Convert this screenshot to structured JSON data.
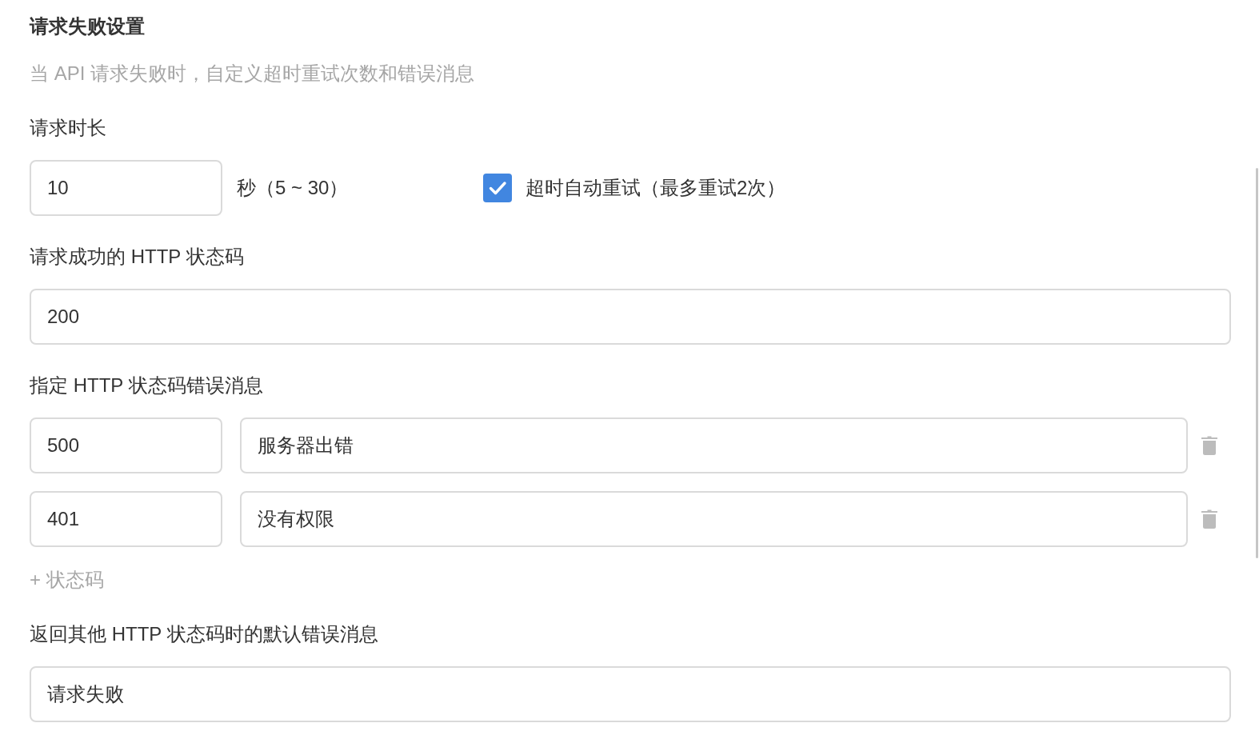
{
  "section": {
    "title": "请求失败设置",
    "description": "当 API 请求失败时，自定义超时重试次数和错误消息"
  },
  "timeout": {
    "label": "请求时长",
    "value": "10",
    "unit": "秒（5 ~ 30）",
    "auto_retry": {
      "label": "超时自动重试（最多重试2次）",
      "checked": true
    }
  },
  "success_code": {
    "label": "请求成功的 HTTP 状态码",
    "value": "200"
  },
  "error_messages": {
    "label": "指定 HTTP 状态码错误消息",
    "rows": [
      {
        "code": "500",
        "message": "服务器出错"
      },
      {
        "code": "401",
        "message": "没有权限"
      }
    ],
    "add_button": "+ 状态码"
  },
  "default_error": {
    "label": "返回其他 HTTP 状态码时的默认错误消息",
    "value": "请求失败"
  }
}
